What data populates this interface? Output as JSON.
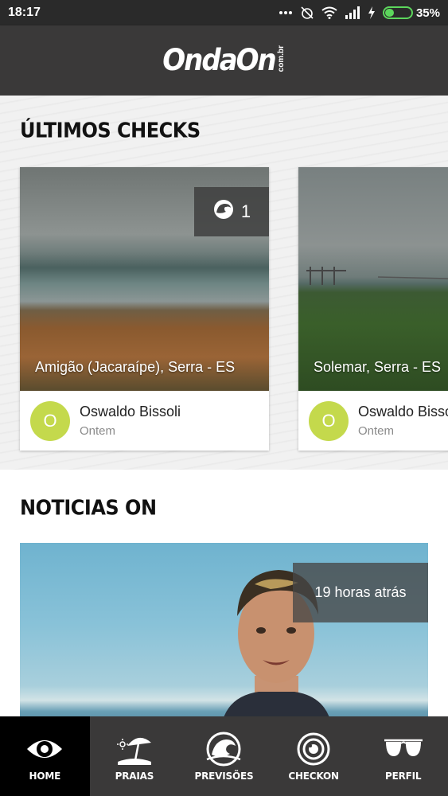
{
  "status_bar": {
    "time": "18:17",
    "battery": "35%",
    "battery_level": 0.35
  },
  "header": {
    "logo_main": "OndaOn",
    "logo_tld": "com.br"
  },
  "checks": {
    "title": "ÚLTIMOS CHECKS",
    "cards": [
      {
        "badge_icon": "wave-icon",
        "badge_count": "1",
        "location": "Amigão (Jacaraípe), Serra - ES",
        "avatar_initial": "O",
        "user_name": "Oswaldo Bissoli",
        "time": "Ontem"
      },
      {
        "location": "Solemar, Serra - ES",
        "avatar_initial": "O",
        "user_name": "Oswaldo Bissoli",
        "time": "Ontem"
      }
    ]
  },
  "news": {
    "title": "NOTICIAS ON",
    "items": [
      {
        "time": "19 horas atrás"
      }
    ]
  },
  "nav": {
    "items": [
      {
        "label": "HOME",
        "icon": "eye-icon",
        "active": true
      },
      {
        "label": "PRAIAS",
        "icon": "beach-umbrella-icon"
      },
      {
        "label": "PREVISÕES",
        "icon": "wave-forecast-icon"
      },
      {
        "label": "CHECKON",
        "icon": "camera-lens-icon"
      },
      {
        "label": "PERFIL",
        "icon": "sunglasses-icon"
      }
    ]
  },
  "colors": {
    "header_bg": "#3a3939",
    "avatar_bg": "#c4d94c",
    "nav_active_bg": "#000000"
  }
}
